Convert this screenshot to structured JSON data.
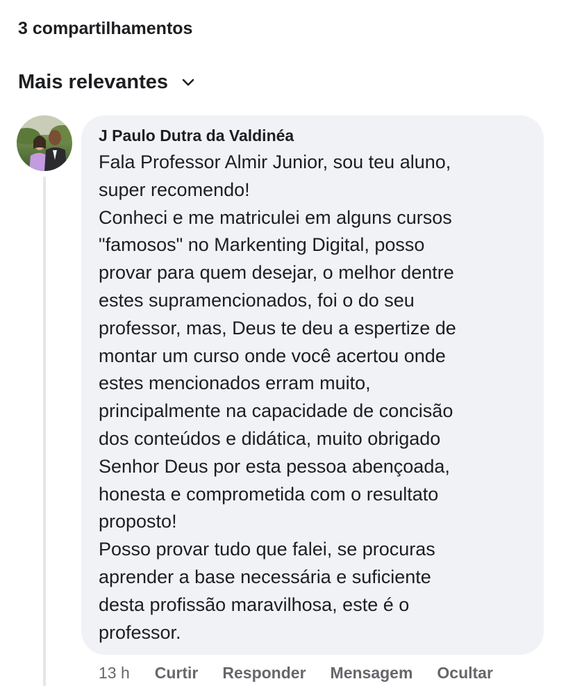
{
  "post": {
    "shares_text": "3 compartilhamentos"
  },
  "comments_filter": {
    "label": "Mais relevantes",
    "icon": "chevron-down-icon"
  },
  "comment": {
    "author": "J Paulo Dutra da Valdinéa",
    "avatar_icon": "profile-photo",
    "lines": [
      "Fala Professor Almir Junior, sou teu aluno,",
      "super recomendo!",
      "Conheci e me matriculei em alguns cursos",
      "\"famosos\" no Markenting Digital, posso",
      "provar para quem desejar, o melhor dentre",
      "estes supramencionados, foi o do seu",
      "professor, mas, Deus te deu a espertize de",
      "montar um curso onde você acertou onde",
      "estes mencionados erram muito,",
      "principalmente na capacidade de concisão",
      "dos conteúdos e didática, muito obrigado",
      "Senhor Deus por esta pessoa abençoada,",
      "honesta e comprometida com o resultato",
      "proposto!",
      "Posso provar tudo que falei, se procuras",
      "aprender a base necessária e suficiente",
      "desta profissão maravilhosa, este é o",
      "professor."
    ],
    "time": "13 h",
    "actions": {
      "like": "Curtir",
      "reply": "Responder",
      "message": "Mensagem",
      "hide": "Ocultar"
    }
  },
  "colors": {
    "bubble_bg": "#f0f2f5",
    "text": "#1c1e21",
    "secondary_text": "#65676b",
    "thread_line": "#e4e6eb"
  }
}
